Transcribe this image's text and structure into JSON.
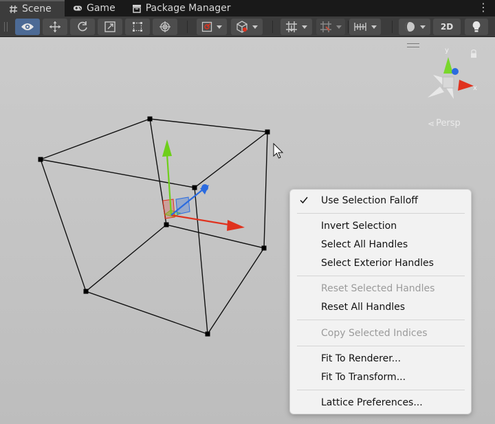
{
  "tabs": [
    {
      "label": "Scene",
      "icon": "hash-icon",
      "active": true
    },
    {
      "label": "Game",
      "icon": "gamepad-icon",
      "active": false
    },
    {
      "label": "Package Manager",
      "icon": "package-icon",
      "active": false
    }
  ],
  "toolbar": {
    "tools": [
      "view-tool",
      "move-tool",
      "rotate-tool",
      "scale-tool",
      "rect-tool",
      "transform-tool"
    ],
    "mode_2d_label": "2D"
  },
  "scene": {
    "persp_label": "Persp",
    "gizmo_axes": {
      "y": "y",
      "x": "x"
    }
  },
  "context_menu": {
    "items": [
      {
        "label": "Use Selection Falloff",
        "checked": true,
        "enabled": true
      },
      {
        "label": "Invert Selection",
        "enabled": true
      },
      {
        "label": "Select All Handles",
        "enabled": true
      },
      {
        "label": "Select Exterior Handles",
        "enabled": true
      },
      {
        "label": "Reset Selected Handles",
        "enabled": false
      },
      {
        "label": "Reset All Handles",
        "enabled": true
      },
      {
        "label": "Copy Selected Indices",
        "enabled": false
      },
      {
        "label": "Fit To Renderer...",
        "enabled": true
      },
      {
        "label": "Fit To Transform...",
        "enabled": true
      },
      {
        "label": "Lattice Preferences...",
        "enabled": true
      }
    ]
  },
  "colors": {
    "axis_x": "#e0321e",
    "axis_y": "#6ecf1a",
    "axis_z": "#2b6bdf",
    "active_tool": "#4c6a95"
  }
}
